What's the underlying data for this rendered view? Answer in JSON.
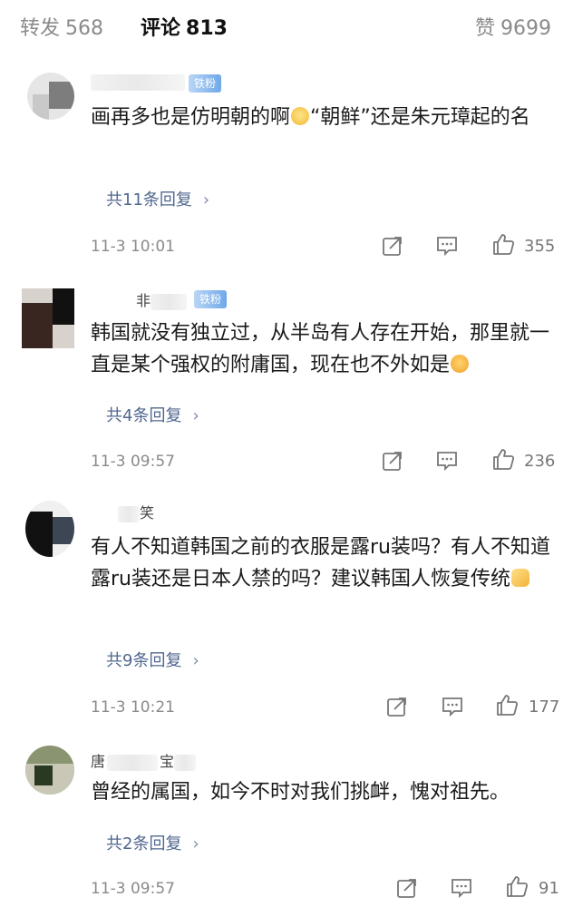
{
  "tabs": {
    "repost": {
      "label": "转发",
      "count": "568"
    },
    "comment": {
      "label": "评论",
      "count": "813"
    },
    "like": {
      "label": "赞",
      "count": "9699"
    }
  },
  "comments": [
    {
      "username": "",
      "badge": "铁粉",
      "text": "画再多也是仿明朝的啊",
      "text_after_emoji": "“朝鲜”还是朱元璋起的名",
      "replies": "共11条回复",
      "time": "11-3 10:01",
      "likes": "355"
    },
    {
      "username": "非",
      "badge": "铁粉",
      "text": "韩国就没有独立过，从半岛有人存在开始，那里就一直是某个强权的附庸国，现在也不外如是",
      "replies": "共4条回复",
      "time": "11-3 09:57",
      "likes": "236"
    },
    {
      "username": "笑",
      "text": "有人不知道韩国之前的衣服是露ru装吗？有人不知道露ru装还是日本人禁的吗？建议韩国人恢复传统",
      "replies": "共9条回复",
      "time": "11-3 10:21",
      "likes": "177"
    },
    {
      "username": "唐",
      "username_tail": "宝",
      "text": "曾经的属国，如今不时对我们挑衅，愧对祖先。",
      "replies": "共2条回复",
      "time": "11-3 09:57",
      "likes": "91"
    }
  ],
  "icons": {
    "repost": "share-icon",
    "comment": "comment-icon",
    "like": "thumbs-up-icon"
  }
}
